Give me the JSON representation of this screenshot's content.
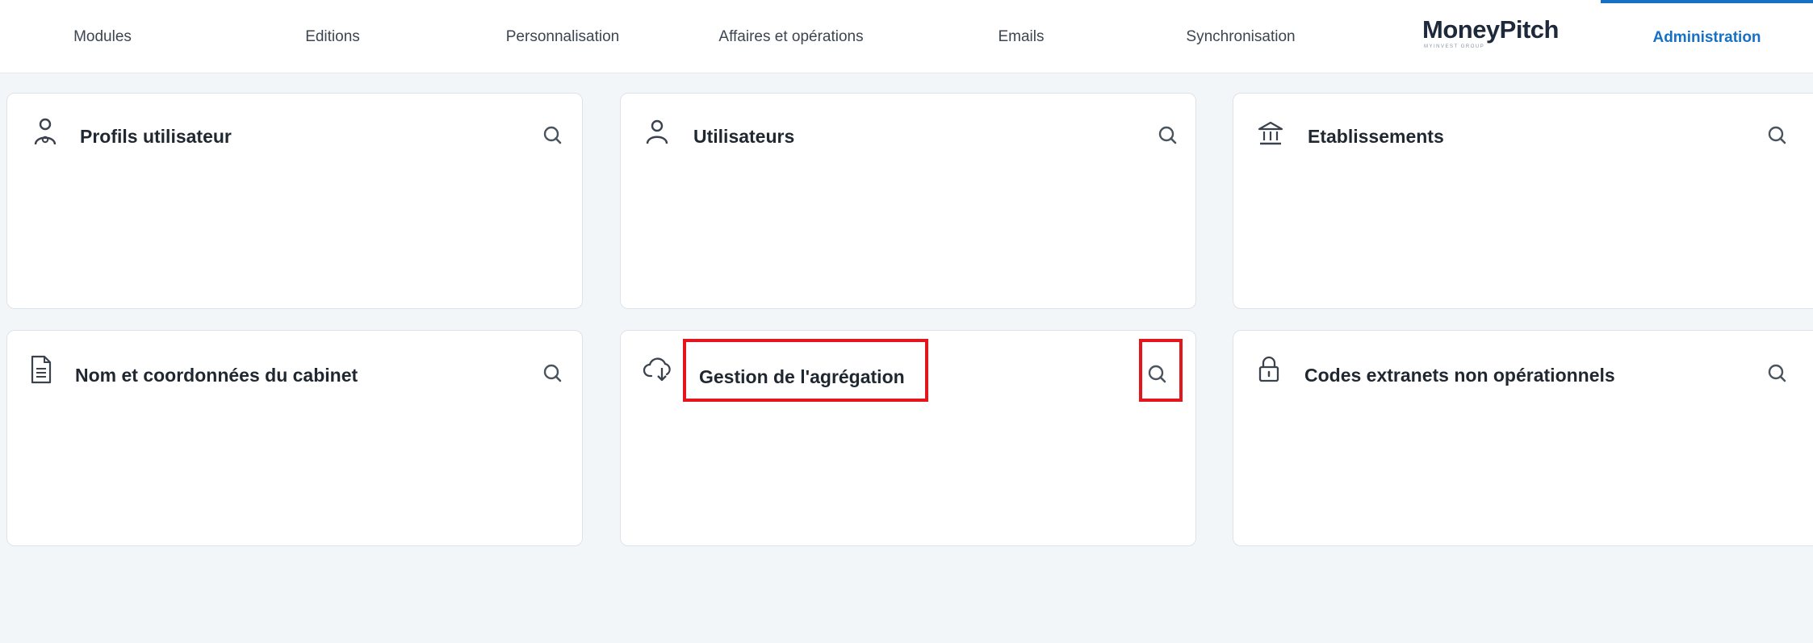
{
  "nav": {
    "tabs": [
      {
        "label": "Modules"
      },
      {
        "label": "Editions"
      },
      {
        "label": "Personnalisation"
      },
      {
        "label": "Affaires et opérations"
      },
      {
        "label": "Emails"
      },
      {
        "label": "Synchronisation"
      }
    ],
    "logo": {
      "text": "MoneyPitch",
      "subtext": "MYINVEST GROUP"
    },
    "active_tab": "Administration"
  },
  "cards": [
    {
      "title": "Profils utilisateur",
      "icon": "user-profile-icon"
    },
    {
      "title": "Utilisateurs",
      "icon": "user-icon"
    },
    {
      "title": "Etablissements",
      "icon": "bank-icon"
    },
    {
      "title": "Nom et coordonnées du cabinet",
      "icon": "document-icon"
    },
    {
      "title": "Gestion de l'agrégation",
      "icon": "cloud-download-icon"
    },
    {
      "title": "Codes extranets non opérationnels",
      "icon": "lock-icon"
    }
  ],
  "colors": {
    "accent": "#1671c5",
    "highlight": "#e3161b",
    "background": "#f3f6f9"
  }
}
